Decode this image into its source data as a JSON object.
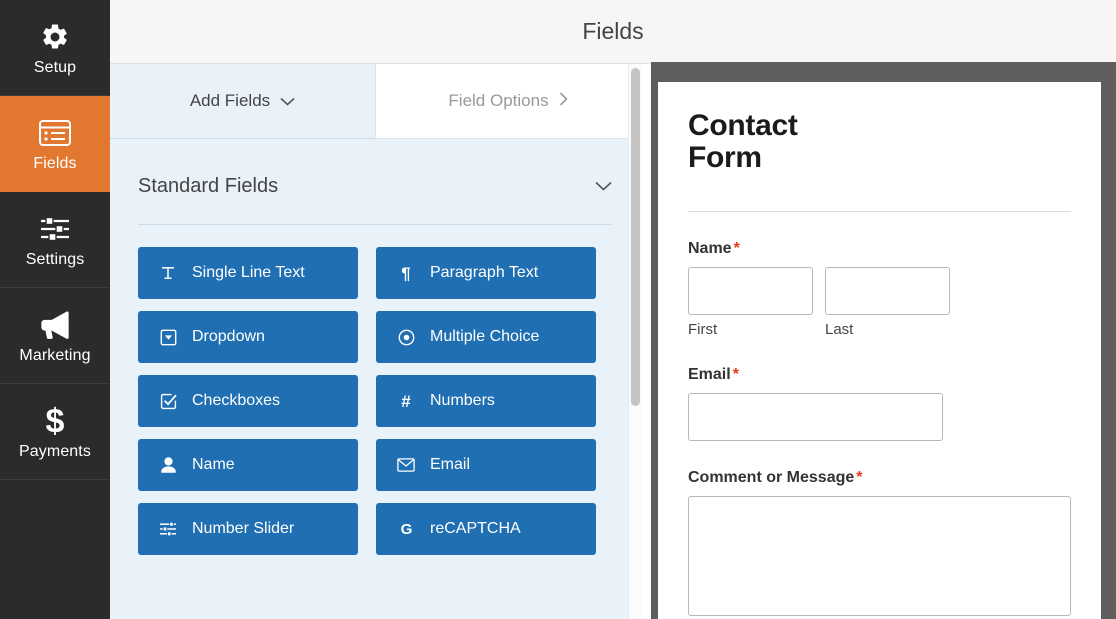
{
  "header": {
    "title": "Fields"
  },
  "sidebar": {
    "items": [
      {
        "label": "Setup",
        "icon": "gear-icon",
        "active": false
      },
      {
        "label": "Fields",
        "icon": "list-form-icon",
        "active": true
      },
      {
        "label": "Settings",
        "icon": "sliders-icon",
        "active": false
      },
      {
        "label": "Marketing",
        "icon": "megaphone-icon",
        "active": false
      },
      {
        "label": "Payments",
        "icon": "dollar-sign-icon",
        "active": false
      }
    ],
    "active_color": "#e27730",
    "background_color": "#2b2b2b"
  },
  "panel": {
    "tabs": [
      {
        "label": "Add Fields",
        "icon": "chevron-down-icon",
        "active": true
      },
      {
        "label": "Field Options",
        "icon": "chevron-right-icon",
        "active": false
      }
    ],
    "section": {
      "title": "Standard Fields",
      "toggle_icon": "chevron-down-icon",
      "fields": [
        {
          "label": "Single Line Text",
          "icon": "text-cursor-icon"
        },
        {
          "label": "Paragraph Text",
          "icon": "pilcrow-icon"
        },
        {
          "label": "Dropdown",
          "icon": "dropdown-caret-icon"
        },
        {
          "label": "Multiple Choice",
          "icon": "radio-button-icon"
        },
        {
          "label": "Checkboxes",
          "icon": "checkbox-checked-icon"
        },
        {
          "label": "Numbers",
          "icon": "hash-icon"
        },
        {
          "label": "Name",
          "icon": "user-icon"
        },
        {
          "label": "Email",
          "icon": "envelope-icon"
        },
        {
          "label": "Number Slider",
          "icon": "sliders-icon"
        },
        {
          "label": "reCAPTCHA",
          "icon": "google-g-icon"
        }
      ]
    },
    "button_color": "#1f6fb2",
    "background_color": "#e9f1f9"
  },
  "preview": {
    "form_title": "Contact Form",
    "required_marker": "*",
    "fields": [
      {
        "label": "Name",
        "required": true,
        "type": "name",
        "sublabels": [
          "First",
          "Last"
        ]
      },
      {
        "label": "Email",
        "required": true,
        "type": "text"
      },
      {
        "label": "Comment or Message",
        "required": true,
        "type": "textarea"
      }
    ],
    "required_color": "#e8361b"
  }
}
